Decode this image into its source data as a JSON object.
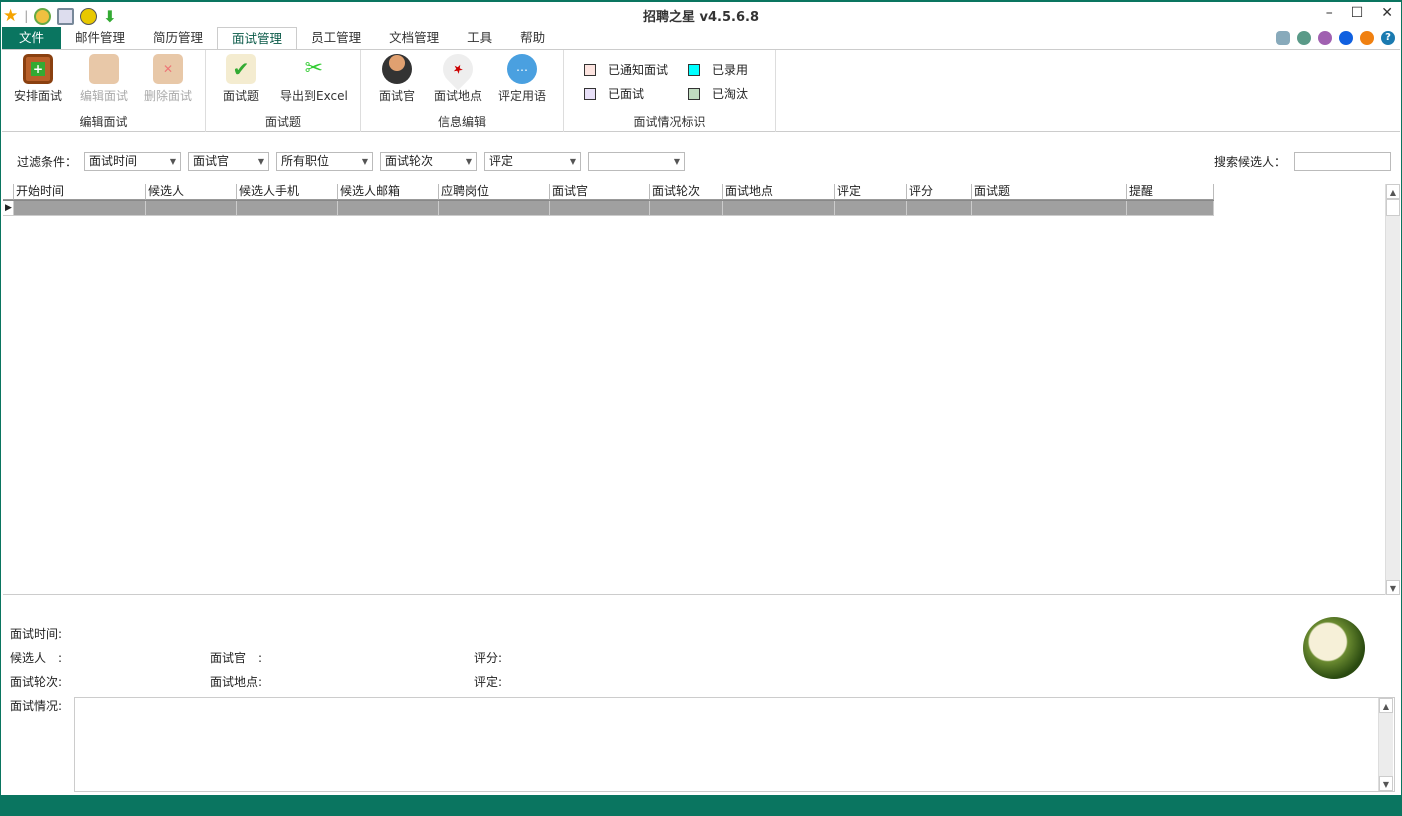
{
  "window": {
    "title": "招聘之星 v4.5.6.8",
    "minimize": "–",
    "maximize": "☐",
    "close": "✕"
  },
  "quick_access": [
    "star-icon",
    "user-icon",
    "board-icon",
    "smiley-icon",
    "download-icon"
  ],
  "tabs": [
    {
      "label": "文件"
    },
    {
      "label": "邮件管理"
    },
    {
      "label": "简历管理"
    },
    {
      "label": "面试管理"
    },
    {
      "label": "员工管理"
    },
    {
      "label": "文档管理"
    },
    {
      "label": "工具"
    },
    {
      "label": "帮助"
    }
  ],
  "ribbon": {
    "groups": [
      {
        "label": "编辑面试",
        "buttons": [
          {
            "label": "安排面试"
          },
          {
            "label": "编辑面试"
          },
          {
            "label": "删除面试"
          }
        ]
      },
      {
        "label": "面试题",
        "buttons": [
          {
            "label": "面试题"
          },
          {
            "label": "导出到Excel"
          }
        ]
      },
      {
        "label": "信息编辑",
        "buttons": [
          {
            "label": "面试官"
          },
          {
            "label": "面试地点"
          },
          {
            "label": "评定用语"
          }
        ]
      },
      {
        "label": "面试情况标识",
        "legend": [
          {
            "label": "已通知面试",
            "color": "#fde4e0"
          },
          {
            "label": "已录用",
            "color": "#00ffff"
          },
          {
            "label": "已面试",
            "color": "#e8e0f8"
          },
          {
            "label": "已淘汰",
            "color": "#c0dcc0"
          }
        ]
      }
    ]
  },
  "filter": {
    "label": "过滤条件：",
    "combos": [
      "面试时间",
      "面试官",
      "所有职位",
      "面试轮次",
      "评定",
      ""
    ],
    "search_label": "搜索候选人：",
    "search_value": ""
  },
  "grid": {
    "columns": [
      "开始时间",
      "候选人",
      "候选人手机",
      "候选人邮箱",
      "应聘岗位",
      "面试官",
      "面试轮次",
      "面试地点",
      "评定",
      "评分",
      "面试题",
      "提醒"
    ]
  },
  "details": {
    "time": "面试时间:",
    "candidate": "候选人　:",
    "interviewer": "面试官　:",
    "score": "评分:",
    "round": "面试轮次:",
    "location": "面试地点:",
    "rating": "评定:",
    "situation": "面试情况:"
  }
}
